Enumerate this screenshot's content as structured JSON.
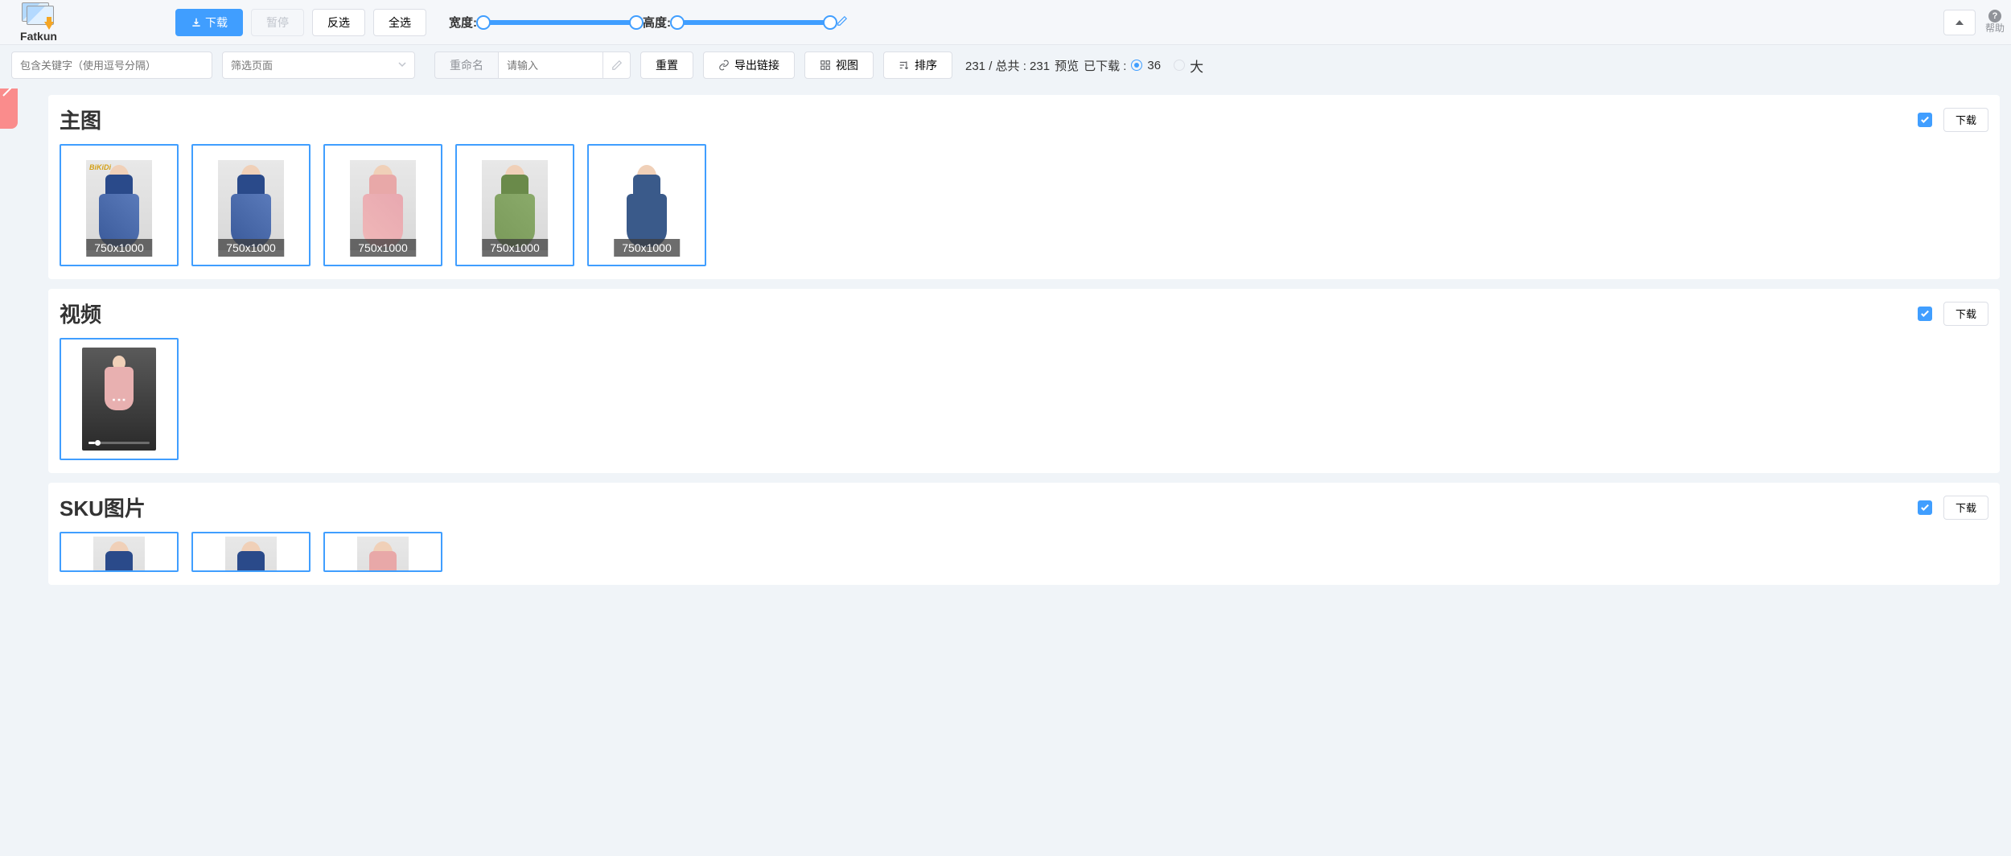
{
  "app": {
    "name": "Fatkun"
  },
  "toolbar": {
    "download": "下载",
    "pause": "暂停",
    "invert": "反选",
    "select_all": "全选",
    "width_label": "宽度:",
    "height_label": "高度:",
    "help": "帮助"
  },
  "filters": {
    "keyword_placeholder": "包含关键字（使用逗号分隔）",
    "page_filter_placeholder": "筛选页面",
    "rename_btn": "重命名",
    "rename_placeholder": "请输入",
    "reset": "重置",
    "export_links": "导出链接",
    "view": "视图",
    "sort": "排序"
  },
  "stats": {
    "text_prefix": "231 / 总共 : 231",
    "preview_label": "预览",
    "downloaded_label": "已下载 :",
    "downloaded_count": "36",
    "size_large": "大"
  },
  "sections": [
    {
      "title": "主图",
      "download_btn": "下载",
      "checked": true,
      "items": [
        {
          "size": "750x1000",
          "variant": "blue",
          "bg": "gray",
          "brand": "BiKiDi"
        },
        {
          "size": "750x1000",
          "variant": "blue",
          "bg": "gray"
        },
        {
          "size": "750x1000",
          "variant": "pink",
          "bg": "gray"
        },
        {
          "size": "750x1000",
          "variant": "green",
          "bg": "gray"
        },
        {
          "size": "750x1000",
          "variant": "navy",
          "bg": "white"
        }
      ]
    },
    {
      "title": "视频",
      "download_btn": "下载",
      "checked": true,
      "items": [
        {
          "type": "video"
        }
      ]
    },
    {
      "title": "SKU图片",
      "download_btn": "下载",
      "checked": true,
      "items": [
        {
          "variant": "blue",
          "bg": "gray",
          "partial": true
        },
        {
          "variant": "blue",
          "bg": "gray",
          "partial": true
        },
        {
          "variant": "pink",
          "bg": "gray",
          "partial": true
        }
      ]
    }
  ],
  "colors": {
    "primary": "#409eff"
  }
}
